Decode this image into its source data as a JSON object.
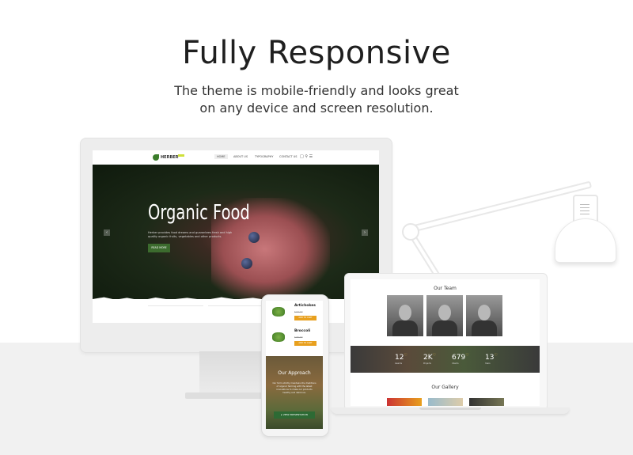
{
  "header": {
    "title": "Fully Responsive",
    "subtitle_line1": "The theme is mobile-friendly and looks great",
    "subtitle_line2": "on any device and screen resolution."
  },
  "desktop_site": {
    "brand": "HERBER",
    "nav": [
      "HOME",
      "ABOUT US",
      "TYPOGRAPHY",
      "CONTACT US"
    ],
    "hero_title": "Organic Food",
    "hero_text": "Herber provides food dreams and guarantees fresh and high quality organic fruits, vegetables and other products.",
    "hero_button": "READ MORE"
  },
  "laptop_site": {
    "team_title": "Our Team",
    "stats": [
      {
        "value": "12",
        "label": "Awards"
      },
      {
        "value": "2K",
        "label": "Projects"
      },
      {
        "value": "679",
        "label": "Clients"
      },
      {
        "value": "13",
        "label": "Years"
      }
    ],
    "gallery_title": "Our Gallery"
  },
  "phone_site": {
    "products": [
      {
        "name": "Artichokes",
        "price": "$24.00",
        "button": "ADD TO CART"
      },
      {
        "name": "Broccoli",
        "price": "$26.00",
        "button": "ADD TO CART"
      }
    ],
    "approach_title": "Our Approach",
    "approach_text": "Our farm strictly maintains the traditions of organic farming with the latest innovations to make our products healthy and delicious.",
    "approach_button": "VIEW PRESENTATION"
  }
}
